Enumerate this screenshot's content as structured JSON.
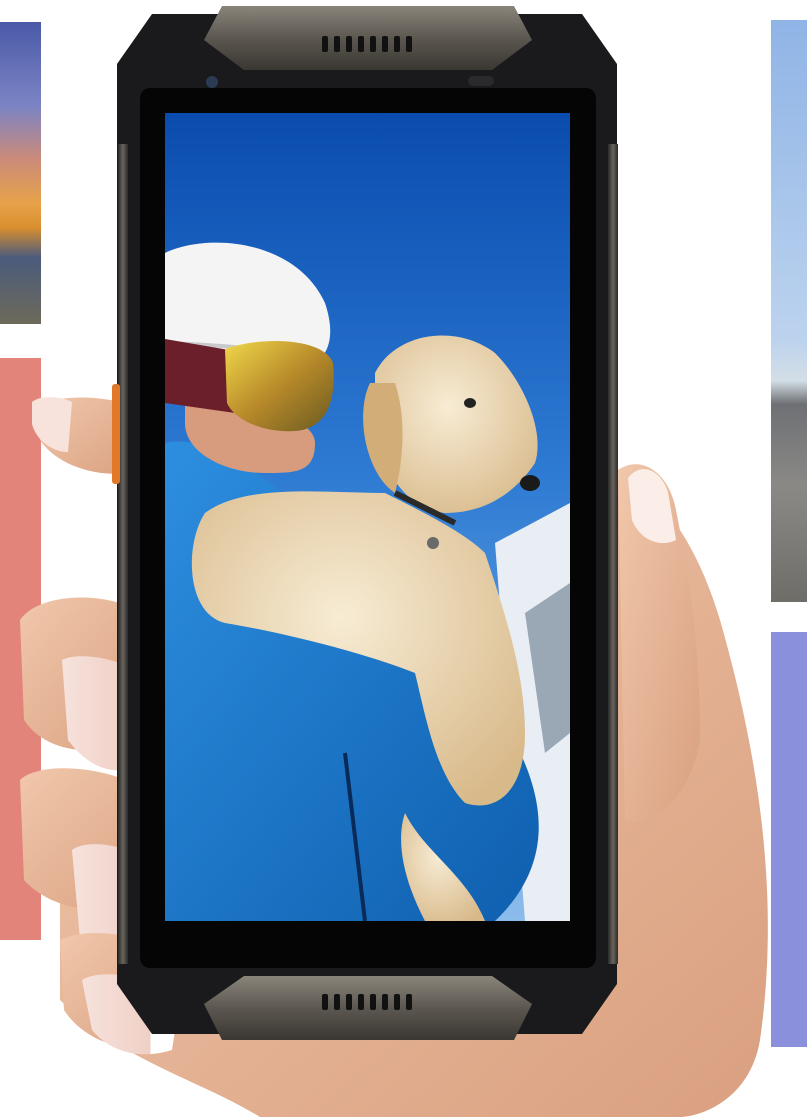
{
  "scene": {
    "subject": "rugged-smartphone-held-in-hand",
    "screen_image": "skier-holding-dog",
    "colors": {
      "phone_frame": "#1c1c1e",
      "phone_metal": "#6e6a62",
      "sky": "#2a76cf",
      "jacket": "#1d7fd0",
      "dog_fur": "#e8d2a8",
      "helmet": "#f2f2f2",
      "goggles": "#d4b22a",
      "skin": "#e9b99b",
      "left_tile": "#e2847a",
      "right_tile": "#8a90dc"
    }
  }
}
